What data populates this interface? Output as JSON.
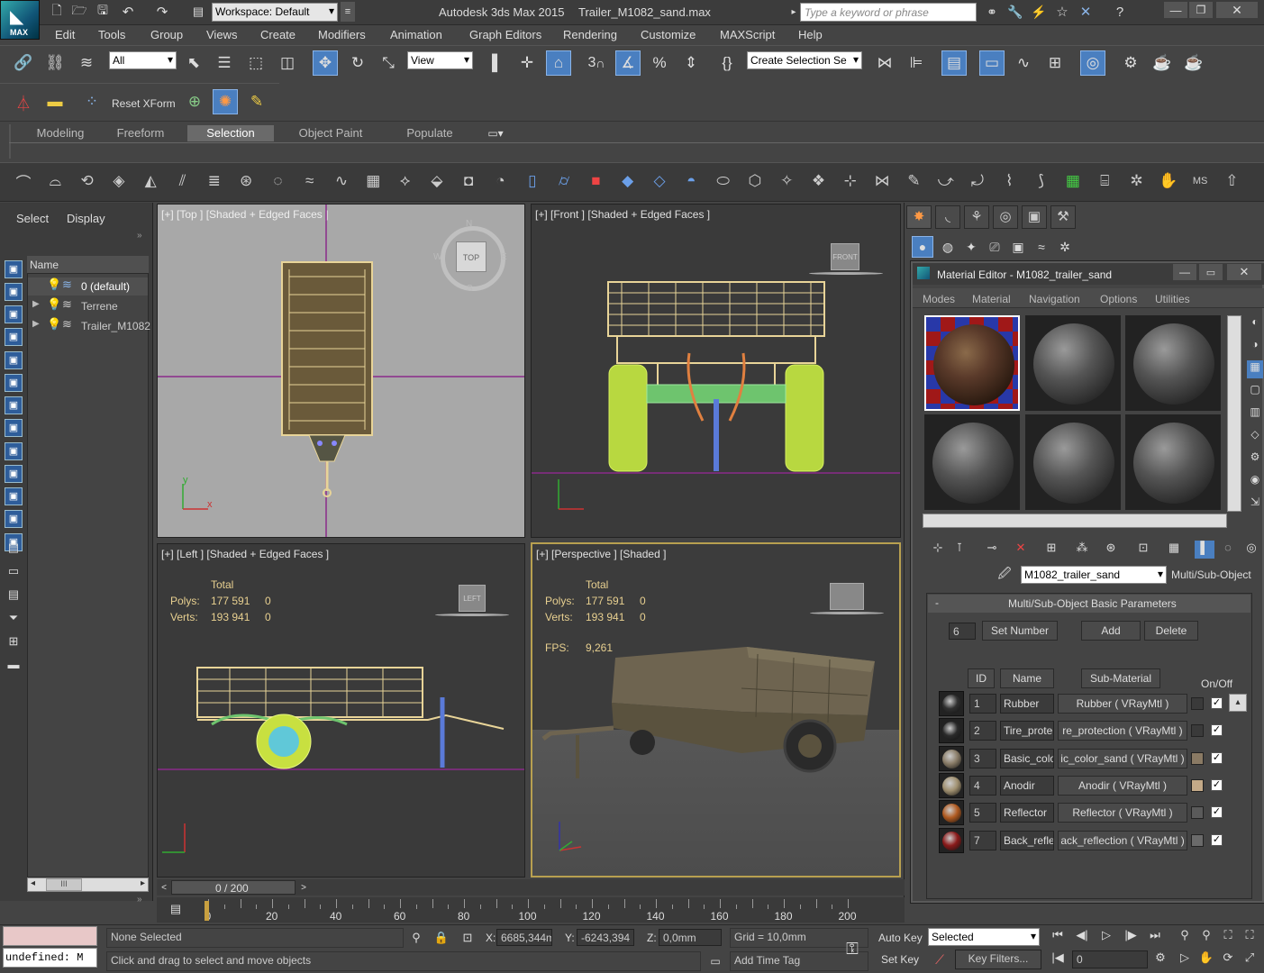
{
  "app": {
    "logo": "MAX",
    "workspace": "Workspace: Default",
    "title": "Autodesk 3ds Max  2015",
    "file": "Trailer_M1082_sand.max",
    "search_placeholder": "Type a keyword or phrase"
  },
  "menu": [
    "Edit",
    "Tools",
    "Group",
    "Views",
    "Create",
    "Modifiers",
    "Animation",
    "Graph Editors",
    "Rendering",
    "Customize",
    "MAXScript",
    "Help"
  ],
  "toolbar": {
    "filter": "All",
    "ref_coord": "View",
    "selection_set": "Create Selection Se",
    "reset_xform": "Reset XForm",
    "snap_label": "3",
    "angle_snap": "%"
  },
  "ribbon_tabs": [
    "Modeling",
    "Freeform",
    "Selection",
    "Object Paint",
    "Populate"
  ],
  "ribbon_active": "Selection",
  "scene_explorer": {
    "tabs": [
      "Select",
      "Display"
    ],
    "column": "Name",
    "items": [
      "0 (default)",
      "Terrene",
      "Trailer_M1082"
    ],
    "scroll_label": "III"
  },
  "viewports": {
    "top": "[+] [Top ] [Shaded + Edged Faces ]",
    "front": "[+] [Front ] [Shaded + Edged Faces ]",
    "left": "[+] [Left ] [Shaded + Edged Faces ]",
    "persp": "[+] [Perspective ] [Shaded ]",
    "viewcube_top": "TOP",
    "viewcube_front": "FRONT",
    "viewcube_left": "LEFT",
    "compass": {
      "n": "N",
      "s": "S",
      "e": "E",
      "w": "W"
    }
  },
  "stats": {
    "total": "Total",
    "polys_label": "Polys:",
    "polys": "177 591",
    "polys_sel": "0",
    "verts_label": "Verts:",
    "verts": "193 941",
    "verts_sel": "0",
    "fps_label": "FPS:",
    "fps": "9,261"
  },
  "material_editor": {
    "title": "Material Editor - M1082_trailer_sand",
    "menus": [
      "Modes",
      "Material",
      "Navigation",
      "Options",
      "Utilities"
    ],
    "material_name": "M1082_trailer_sand",
    "material_type": "Multi/Sub-Object",
    "rollout": "Multi/Sub-Object Basic Parameters",
    "set_number_value": "6",
    "set_number": "Set Number",
    "add": "Add",
    "delete": "Delete",
    "col_id": "ID",
    "col_name": "Name",
    "col_sub": "Sub-Material",
    "col_onoff": "On/Off",
    "rows": [
      {
        "id": "1",
        "name": "Rubber",
        "sub": "Rubber  ( VRayMtl )",
        "color": "#3a3a3a",
        "ball": "#303030"
      },
      {
        "id": "2",
        "name": "Tire_prote",
        "sub": "re_protection  ( VRayMtl )",
        "color": "#3a3a3a",
        "ball": "#2a2a2a"
      },
      {
        "id": "3",
        "name": "Basic_colo",
        "sub": "ic_color_sand  ( VRayMtl )",
        "color": "#8a7a64",
        "ball": "#8a7d68"
      },
      {
        "id": "4",
        "name": "Anodir",
        "sub": "Anodir  ( VRayMtl )",
        "color": "#c4aa88",
        "ball": "#a09070"
      },
      {
        "id": "5",
        "name": "Reflector",
        "sub": "Reflector  ( VRayMtl )",
        "color": "#5a5a5a",
        "ball": "#b05a20"
      },
      {
        "id": "7",
        "name": "Back_refle",
        "sub": "ack_reflection  ( VRayMtl )",
        "color": "#6a6a6a",
        "ball": "#8a1a1a"
      }
    ]
  },
  "command_panel_tabs": [
    "create",
    "modify",
    "hierarchy",
    "motion",
    "display",
    "utilities"
  ],
  "timeline": {
    "frame": "0 / 200",
    "ticks": [
      "0",
      "20",
      "40",
      "60",
      "80",
      "100",
      "120",
      "140",
      "160",
      "180",
      "200"
    ]
  },
  "status": {
    "maxscript": "undefined: M",
    "selected": "None Selected",
    "prompt": "Click and drag to select and move objects",
    "x_label": "X:",
    "x": "6685,344m",
    "y_label": "Y:",
    "y": "-6243,394",
    "z_label": "Z:",
    "z": "0,0mm",
    "grid": "Grid = 10,0mm",
    "add_time_tag": "Add Time Tag",
    "auto_key": "Auto Key",
    "set_key": "Set Key",
    "selected_dd": "Selected",
    "key_filters": "Key Filters...",
    "frame_field": "0"
  },
  "colors": {
    "accent": "#4a7fc0",
    "wire": "#e8d498",
    "grid_axis": "#8a2a8a",
    "stat_text": "#e8d090",
    "persp_border": "#b8a050"
  }
}
